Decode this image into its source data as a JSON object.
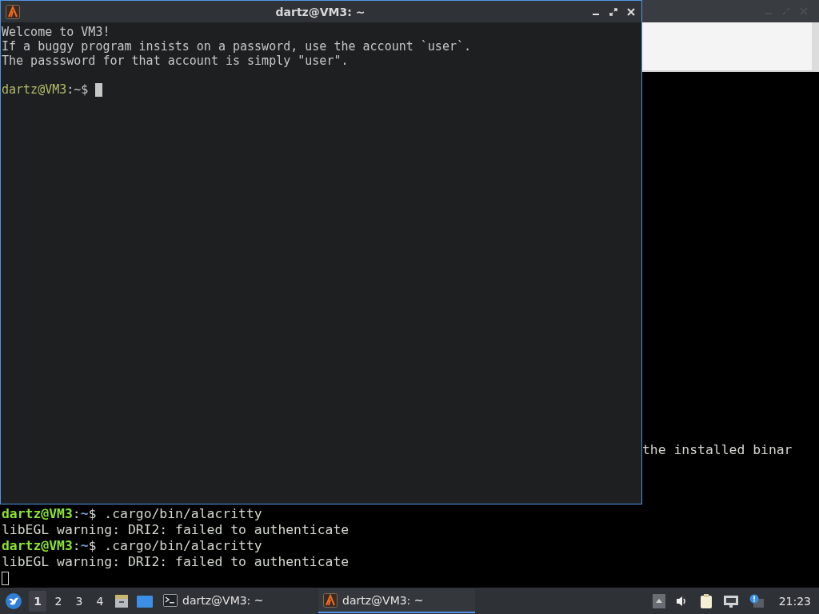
{
  "background_terminal": {
    "lines": [
      {
        "kind": "partial",
        "text": "the installed binar"
      },
      {
        "kind": "blank"
      },
      {
        "kind": "blank"
      },
      {
        "kind": "blank"
      },
      {
        "kind": "prompt",
        "user_host": "dartz@VM3",
        "separator": ":",
        "path": "~",
        "command": "$ .cargo/bin/alacritty"
      },
      {
        "kind": "output",
        "text": "libEGL warning: DRI2: failed to authenticate"
      },
      {
        "kind": "prompt",
        "user_host": "dartz@VM3",
        "separator": ":",
        "path": "~",
        "command": "$ .cargo/bin/alacritty"
      },
      {
        "kind": "output",
        "text": "libEGL warning: DRI2: failed to authenticate"
      },
      {
        "kind": "cursor"
      }
    ]
  },
  "terminal_window": {
    "title": "dartz@VM3: ~",
    "lines": [
      {
        "kind": "output",
        "text": "Welcome to VM3!"
      },
      {
        "kind": "output",
        "text": "If a buggy program insists on a password, use the account `user`."
      },
      {
        "kind": "output",
        "text": "The passsword for that account is simply \"user\"."
      },
      {
        "kind": "blank"
      },
      {
        "kind": "prompt",
        "user_host": "dartz@VM3",
        "separator": ":",
        "path": "~",
        "command": "$ "
      },
      {
        "kind": "cursor_inline"
      }
    ]
  },
  "taskbar": {
    "desktops": [
      {
        "label": "1",
        "selected": true
      },
      {
        "label": "2",
        "selected": false
      },
      {
        "label": "3",
        "selected": false
      },
      {
        "label": "4",
        "selected": false
      }
    ],
    "tasks": [
      {
        "label": "dartz@VM3: ~",
        "kind": "terminal",
        "selected": false
      },
      {
        "label": "dartz@VM3: ~",
        "kind": "alacritty",
        "selected": true
      }
    ],
    "clock": "21:23"
  }
}
